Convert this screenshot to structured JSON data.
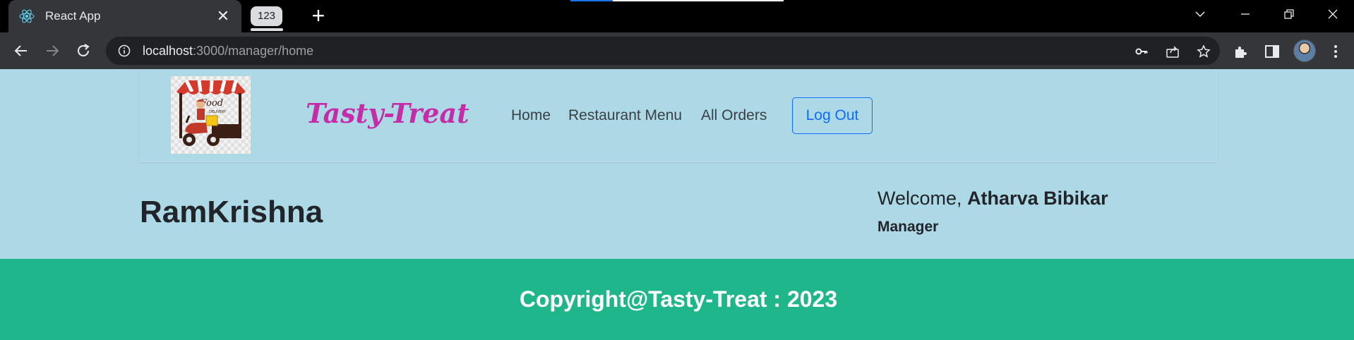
{
  "browser": {
    "tab_title": "React App",
    "tab_close": "✕",
    "tab_group_label": "123",
    "new_tab": "+",
    "url_host": "localhost",
    "url_rest": ":3000/manager/home",
    "colors": {
      "tabbar": "#000000",
      "toolbar": "#35363a",
      "omnibox": "#202124"
    }
  },
  "navbar": {
    "brand": "Tasty-Treat",
    "links": [
      "Home",
      "Restaurant Menu",
      "All Orders"
    ],
    "logout_label": "Log Out",
    "logo_text_top": "Food",
    "logo_text_bottom": "DELIVERY"
  },
  "main": {
    "restaurant_name": "RamKrishna",
    "welcome_prefix": "Welcome,",
    "user_name": "Atharva Bibikar",
    "role": "Manager"
  },
  "footer": {
    "copyright": "Copyright@Tasty-Treat : 2023"
  },
  "colors": {
    "page_bg": "#ADD8E6",
    "brand": "#c62ba8",
    "footer_bg": "#20b68c",
    "logout": "#0d6efd"
  }
}
